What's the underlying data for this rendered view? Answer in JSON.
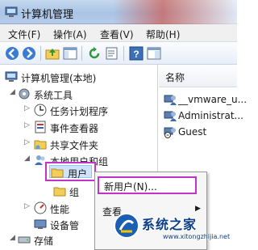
{
  "window": {
    "title": "计算机管理"
  },
  "menu": {
    "items": [
      "文件(F)",
      "操作(A)",
      "查看(V)",
      "帮助(H)"
    ]
  },
  "toolbar": {
    "buttons": [
      "back-icon",
      "forward-icon",
      "up-folder-icon",
      "show-hide-tree-icon",
      "refresh-icon",
      "export-list-icon",
      "help-icon",
      "properties-icon"
    ]
  },
  "tree": {
    "root": "计算机管理(本地)",
    "system_tools": "系统工具",
    "task_scheduler": "任务计划程序",
    "event_viewer": "事件查看器",
    "shared_folders": "共享文件夹",
    "local_users_groups": "本地用户和组",
    "users": "用户",
    "groups": "组",
    "performance": "性能",
    "device_manager": "设备管",
    "storage": "存储"
  },
  "list": {
    "column_name": "名称",
    "rows": [
      "__vmware_u...",
      "Administrat...",
      "Guest"
    ]
  },
  "context_menu": {
    "new_user": "新用户(N)...",
    "view": "查看"
  },
  "watermark": {
    "text": "系统之家",
    "url": "www.xitongzhijia.net"
  },
  "colors": {
    "highlight_border": "#c233c8",
    "selection_fill": "#cfe3fb",
    "title_bar": "#a9c4e6"
  }
}
